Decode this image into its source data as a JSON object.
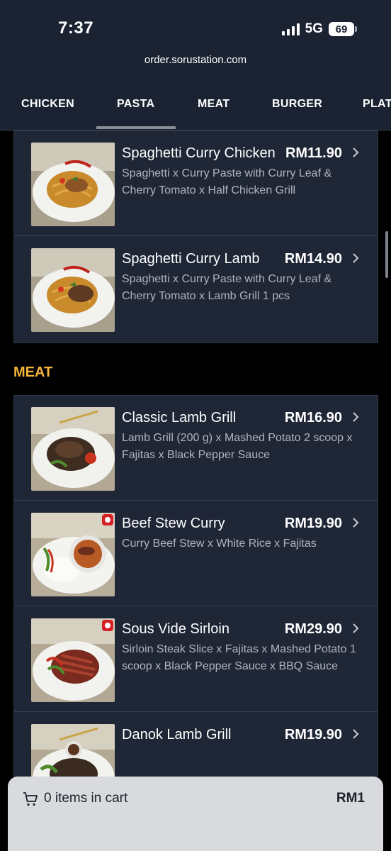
{
  "status": {
    "time": "7:37",
    "network": "5G",
    "battery": "69"
  },
  "browser": {
    "url": "order.sorustation.com"
  },
  "tabs": [
    "CHICKEN",
    "PASTA",
    "MEAT",
    "BURGER",
    "PLAT"
  ],
  "active_tab": "PASTA",
  "pasta_items": [
    {
      "name": "Spaghetti Curry Chicken",
      "price": "RM11.90",
      "desc": "Spaghetti x Curry Paste with Curry Leaf & Cherry Tomato x Half Chicken Grill"
    },
    {
      "name": "Spaghetti Curry Lamb",
      "price": "RM14.90",
      "desc": "Spaghetti x Curry Paste with Curry Leaf & Cherry Tomato x Lamb Grill 1 pcs"
    }
  ],
  "meat_section": {
    "title": "MEAT",
    "items": [
      {
        "name": "Classic Lamb Grill",
        "price": "RM16.90",
        "desc": "Lamb Grill (200 g) x Mashed Potato 2 scoop x Fajitas x Black Pepper Sauce",
        "spicy": false
      },
      {
        "name": "Beef Stew Curry",
        "price": "RM19.90",
        "desc": "Curry Beef Stew x White Rice x Fajitas",
        "spicy": true
      },
      {
        "name": "Sous Vide Sirloin",
        "price": "RM29.90",
        "desc": "Sirloin Steak Slice x Fajitas x Mashed Potato 1 scoop x Black Pepper Sauce x BBQ Sauce",
        "spicy": true
      },
      {
        "name": "Danok Lamb Grill",
        "price": "RM19.90",
        "desc": "",
        "spicy": false
      }
    ]
  },
  "cart": {
    "label": "0 items in cart",
    "total": "RM1"
  },
  "colors": {
    "accent": "#f5b53a",
    "card_bg": "#1f2636",
    "header_bg": "#1b2232"
  }
}
